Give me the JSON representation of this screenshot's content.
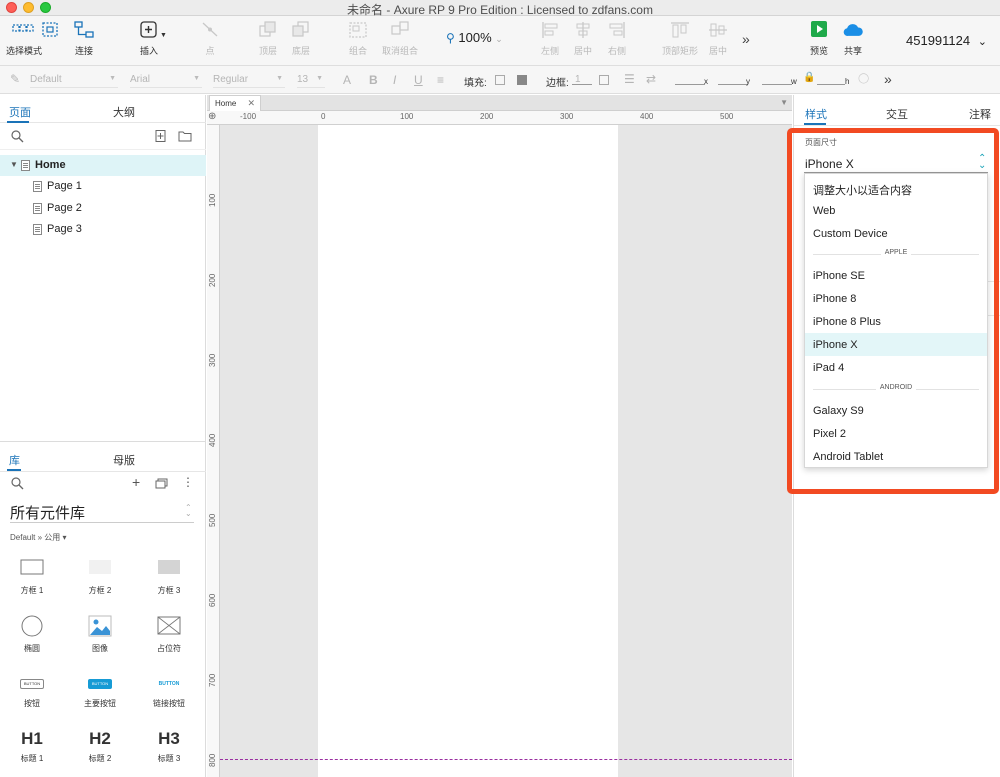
{
  "window": {
    "title": "未命名 - Axure RP 9 Pro Edition : Licensed to zdfans.com"
  },
  "toolbar": {
    "select_mode": "选择模式",
    "connect": "连接",
    "insert": "插入",
    "point": "点",
    "top": "顶层",
    "back": "底层",
    "group": "组合",
    "ungroup": "取消组合",
    "zoom": "100%",
    "align_left": "左侧",
    "align_center": "居中",
    "align_right": "右侧",
    "top_rect": "顶部矩形",
    "middle": "居中",
    "preview": "预览",
    "share": "共享",
    "user": "451991124"
  },
  "format": {
    "style": "Default",
    "font": "Arial",
    "weight": "Regular",
    "size": "13",
    "fill_label": "填充:",
    "border_label": "边框:",
    "border_value": "1",
    "x": "x",
    "y": "y",
    "w": "w",
    "h": "h"
  },
  "left_panel": {
    "tabs": [
      "页面",
      "大纲"
    ],
    "pages": [
      {
        "name": "Home",
        "selected": true
      },
      {
        "name": "Page 1"
      },
      {
        "name": "Page 2"
      },
      {
        "name": "Page 3"
      }
    ],
    "lib_tabs": [
      "库",
      "母版"
    ],
    "library_title": "所有元件库",
    "library_sub": "Default » 公用 ▾",
    "widgets": [
      {
        "label": "方框 1"
      },
      {
        "label": "方框 2"
      },
      {
        "label": "方框 3"
      },
      {
        "label": "椭圆"
      },
      {
        "label": "图像"
      },
      {
        "label": "占位符"
      },
      {
        "label": "按钮",
        "text": "BUTTON"
      },
      {
        "label": "主要按钮",
        "text": "BUTTON"
      },
      {
        "label": "链接按钮",
        "text": "BUTTON"
      },
      {
        "label": "标题 1",
        "text": "H1"
      },
      {
        "label": "标题 2",
        "text": "H2"
      },
      {
        "label": "标题 3",
        "text": "H3"
      }
    ]
  },
  "canvas": {
    "tab": "Home",
    "hruler": [
      "-100",
      "0",
      "100",
      "200",
      "300",
      "400",
      "500"
    ],
    "vruler": [
      "100",
      "200",
      "300",
      "400",
      "500",
      "600",
      "700",
      "800"
    ]
  },
  "right_panel": {
    "tabs": [
      "样式",
      "交互",
      "注释"
    ],
    "page_size_label": "页面尺寸",
    "page_size_value": "iPhone X",
    "options": {
      "fit": "调整大小以适合内容",
      "web": "Web",
      "custom": "Custom Device",
      "apple_header": "APPLE",
      "apple": [
        "iPhone SE",
        "iPhone 8",
        "iPhone 8 Plus",
        "iPhone X",
        "iPad 4"
      ],
      "android_header": "ANDROID",
      "android": [
        "Galaxy S9",
        "Pixel 2",
        "Android Tablet"
      ]
    },
    "selected_option": "iPhone X",
    "highlight_color": "#f24a22"
  }
}
